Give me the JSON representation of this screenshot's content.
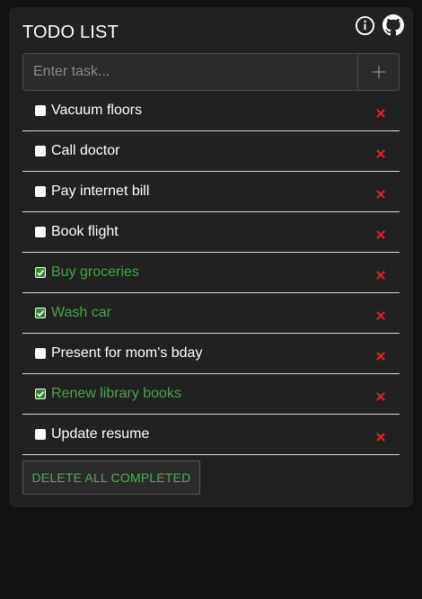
{
  "app": {
    "title": "TODO LIST"
  },
  "header": {
    "icons": [
      "info-icon",
      "github-icon"
    ]
  },
  "input": {
    "placeholder": "Enter task...",
    "value": "",
    "add_icon": "plus-icon"
  },
  "todos": [
    {
      "label": "Vacuum floors",
      "completed": false
    },
    {
      "label": "Call doctor",
      "completed": false
    },
    {
      "label": "Pay internet bill",
      "completed": false
    },
    {
      "label": "Book flight",
      "completed": false
    },
    {
      "label": "Buy groceries",
      "completed": true
    },
    {
      "label": "Wash car",
      "completed": true
    },
    {
      "label": "Present for mom's bday",
      "completed": false
    },
    {
      "label": "Renew library books",
      "completed": true
    },
    {
      "label": "Update resume",
      "completed": false
    }
  ],
  "actions": {
    "delete_all_completed": "DELETE ALL COMPLETED"
  },
  "colors": {
    "background": "#121212",
    "card": "#212121",
    "completed_text": "#48a148",
    "delete_icon": "#e02020",
    "text": "#ffffff"
  }
}
